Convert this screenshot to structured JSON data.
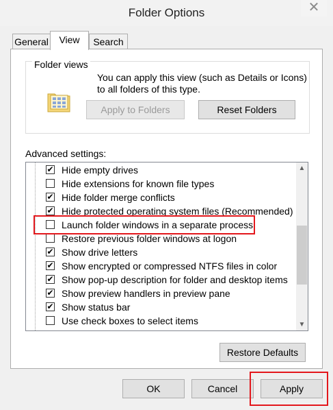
{
  "window": {
    "title": "Folder Options",
    "close_glyph": "✕"
  },
  "tabs": [
    {
      "label": "General",
      "active": false
    },
    {
      "label": "View",
      "active": true
    },
    {
      "label": "Search",
      "active": false
    }
  ],
  "folder_views": {
    "legend": "Folder views",
    "description": "You can apply this view (such as Details or Icons) to all folders of this type.",
    "apply_button": "Apply to Folders",
    "reset_button": "Reset Folders"
  },
  "advanced": {
    "label": "Advanced settings:",
    "items": [
      {
        "label": "Hide empty drives",
        "checked": true
      },
      {
        "label": "Hide extensions for known file types",
        "checked": false
      },
      {
        "label": "Hide folder merge conflicts",
        "checked": true
      },
      {
        "label": "Hide protected operating system files (Recommended)",
        "checked": true
      },
      {
        "label": "Launch folder windows in a separate process",
        "checked": false
      },
      {
        "label": "Restore previous folder windows at logon",
        "checked": false
      },
      {
        "label": "Show drive letters",
        "checked": true
      },
      {
        "label": "Show encrypted or compressed NTFS files in color",
        "checked": true
      },
      {
        "label": "Show pop-up description for folder and desktop items",
        "checked": true
      },
      {
        "label": "Show preview handlers in preview pane",
        "checked": true
      },
      {
        "label": "Show status bar",
        "checked": true
      },
      {
        "label": "Use check boxes to select items",
        "checked": false
      }
    ],
    "restore_defaults": "Restore Defaults"
  },
  "footer": {
    "ok": "OK",
    "cancel": "Cancel",
    "apply": "Apply"
  },
  "colors": {
    "highlight": "#e3161b",
    "dialog_bg": "#f0f0f0",
    "panel_bg": "#ffffff"
  }
}
